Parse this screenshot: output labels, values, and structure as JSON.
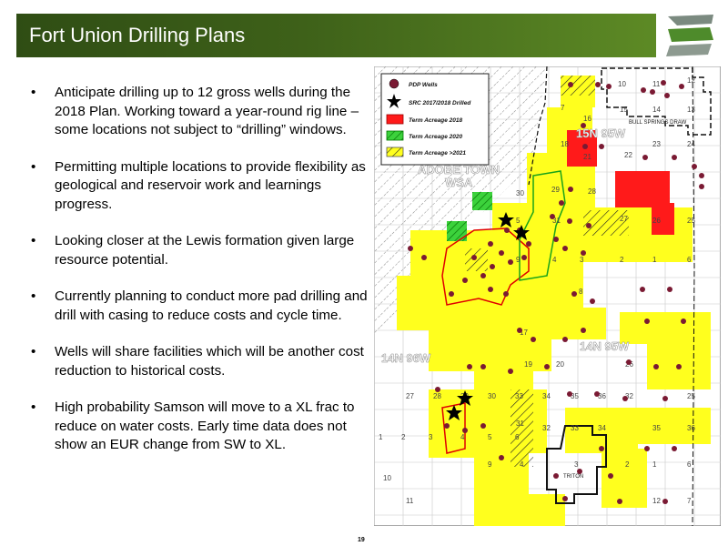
{
  "slide": {
    "title": "Fort Union Drilling Plans",
    "page_number": "19",
    "bullets": [
      "Anticipate drilling up to 12 gross wells during the 2018 Plan.   Working toward a year-round rig line  – some locations not subject to “drilling” windows.",
      "Permitting multiple locations to provide flexibility as geological and reservoir work and learnings progress.",
      "Looking closer at the Lewis formation given large resource potential.",
      "Currently planning to conduct more pad drilling and drill with casing to reduce costs and cycle time.",
      "Wells will share facilities which will be another cost reduction to historical costs.",
      "High probability Samson will move to a XL frac to reduce on water costs. Early time data does not show an EUR change from SW to XL."
    ]
  },
  "map": {
    "legend": [
      {
        "label": "PDP Wells",
        "symbol": "well-dot-icon"
      },
      {
        "label": "SRC 2017/2018 Drilled",
        "symbol": "black-star-icon"
      },
      {
        "label": "Term Acreage 2018",
        "symbol": "red-hatch-swatch"
      },
      {
        "label": "Term Acreage 2020",
        "symbol": "green-hatch-swatch"
      },
      {
        "label": "Term Acreage >2021",
        "symbol": "yellow-hatch-swatch"
      }
    ],
    "area_labels": {
      "adobe_town": "ADOBE TOWN",
      "wsa": "WSA",
      "twp_15n": "15N 95W",
      "twp_14n": "14N 95W",
      "twp_96w": "14N 96W",
      "bull": "BULL SPRINGS DRAW",
      "triton": "TRITON"
    },
    "section_numbers": [
      "10",
      "11",
      "12",
      "7",
      "16",
      "15",
      "14",
      "13",
      "18",
      "21",
      "22",
      "23",
      "24",
      "28",
      "27",
      "26",
      "25",
      "30",
      "29",
      "33",
      "34",
      "35",
      "36",
      "32",
      "31",
      "5",
      "4",
      "3",
      "2",
      "1",
      "6",
      "9",
      "8",
      "17",
      "20",
      "19",
      "6",
      "5",
      "4",
      "3",
      "2",
      "1",
      "26",
      "25",
      "30",
      "29",
      "28",
      "27",
      "35",
      "36",
      "31",
      "32",
      "33",
      "34",
      "3",
      "2",
      "1",
      "6",
      "4",
      "9",
      "10",
      "11",
      "12",
      "7"
    ],
    "colors": {
      "yellow": "#ffff1e",
      "red": "#ff1a1a",
      "green": "#3cd23c",
      "well": "#7a1a33",
      "header": "#3e6119"
    }
  }
}
